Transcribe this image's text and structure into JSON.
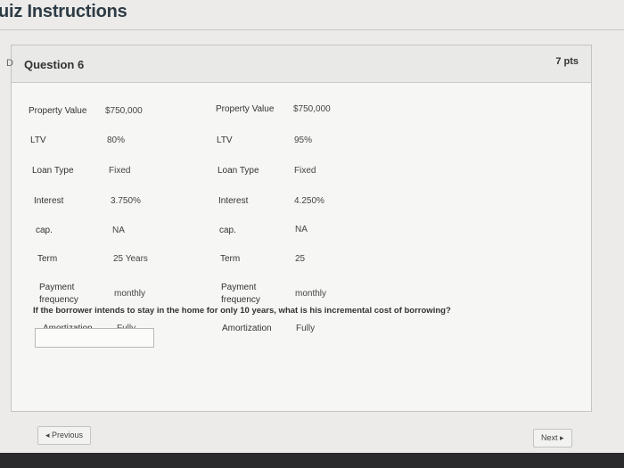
{
  "page": {
    "title": "uiz Instructions"
  },
  "question": {
    "header_glyph": "D",
    "name": "Question 6",
    "points": "7 pts",
    "prompt": "If the borrower intends to stay in the home for only 10 years, what is his incremental cost of borrowing?",
    "answer_value": ""
  },
  "left_table": {
    "property_value": {
      "label": "Property Value",
      "value": "$750,000"
    },
    "ltv": {
      "label": "LTV",
      "value": "80%"
    },
    "loan_type": {
      "label": "Loan Type",
      "value": "Fixed"
    },
    "interest": {
      "label": "Interest",
      "value": "3.750%"
    },
    "cap": {
      "label": "cap.",
      "value": "NA"
    },
    "term": {
      "label": "Term",
      "value": "25 Years"
    },
    "payment_frequency": {
      "label_line1": "Payment",
      "label_line2": "frequency",
      "value": "monthly"
    },
    "amortization": {
      "label": "Amortization",
      "value": "Fully"
    }
  },
  "right_table": {
    "property_value": {
      "label": "Property Value",
      "value": "$750,000"
    },
    "ltv": {
      "label": "LTV",
      "value": "95%"
    },
    "loan_type": {
      "label": "Loan Type",
      "value": "Fixed"
    },
    "interest": {
      "label": "Interest",
      "value": "4.250%"
    },
    "cap": {
      "label": "cap.",
      "value": "NA"
    },
    "term": {
      "label": "Term",
      "value": "25"
    },
    "payment_frequency": {
      "label_line1": "Payment",
      "label_line2": "frequency",
      "value": "monthly"
    },
    "amortization": {
      "label": "Amortization",
      "value": "Fully"
    }
  },
  "navigation": {
    "previous_label": "◂ Previous",
    "next_label": "Next ▸"
  }
}
